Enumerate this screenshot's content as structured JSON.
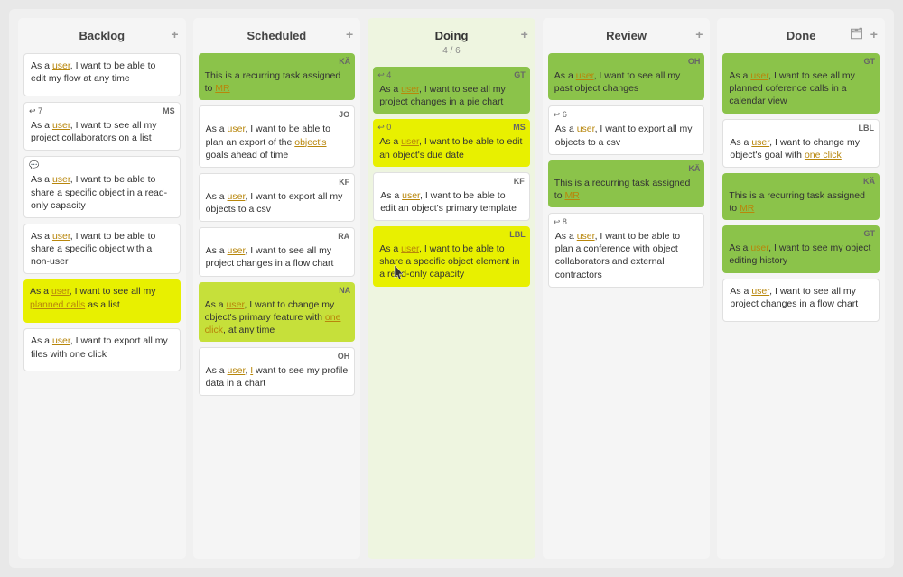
{
  "board": {
    "columns": [
      {
        "id": "backlog",
        "label": "Backlog",
        "sub": "",
        "cards": [
          {
            "id": "b1",
            "bg": "white",
            "text": "As a user, I want to be able to edit my flow at any time",
            "tag": "",
            "num": "",
            "hasIcon": false,
            "links": [
              "user"
            ]
          },
          {
            "id": "b2",
            "bg": "white",
            "tag": "MS",
            "num": "7",
            "text": "As a user, I want to see all my project collaborators on a list",
            "links": [
              "user"
            ],
            "hasIcon": true
          },
          {
            "id": "b3",
            "bg": "white",
            "tag": "",
            "num": "",
            "text": "As a user, I want to be able to share a specific object in a read-only capacity",
            "links": [
              "user"
            ],
            "hasIcon": true,
            "hasBubble": true
          },
          {
            "id": "b4",
            "bg": "white",
            "tag": "",
            "num": "",
            "text": "As a user, I want to be able to share a specific object with a non-user",
            "links": [
              "user"
            ],
            "hasIcon": false
          },
          {
            "id": "b5",
            "bg": "yellow",
            "tag": "",
            "num": "",
            "text": "As a user, I want to see all my planned calls as a list",
            "links": [
              "user",
              "planned calls"
            ],
            "hasIcon": false
          },
          {
            "id": "b6",
            "bg": "white",
            "tag": "",
            "num": "",
            "text": "As a user, I want to export all my files with one click",
            "links": [
              "user"
            ],
            "hasIcon": false
          }
        ]
      },
      {
        "id": "scheduled",
        "label": "Scheduled",
        "sub": "",
        "cards": [
          {
            "id": "s1",
            "bg": "green",
            "tag": "KÄ",
            "num": "",
            "text": "This is a recurring task assigned to MR",
            "links": [
              "MR"
            ]
          },
          {
            "id": "s2",
            "bg": "white",
            "tag": "JO",
            "num": "",
            "text": "As a user, I want to be able to plan an export of the object's goals ahead of time",
            "links": [
              "user",
              "object's"
            ]
          },
          {
            "id": "s3",
            "bg": "white",
            "tag": "KF",
            "num": "",
            "text": "As a user, I want to export all my objects to a csv",
            "links": [
              "user"
            ]
          },
          {
            "id": "s4",
            "bg": "white",
            "tag": "RA",
            "num": "",
            "text": "As a user, I want to see all my project changes in a flow chart",
            "links": [
              "user"
            ]
          },
          {
            "id": "s5",
            "bg": "lime",
            "tag": "NA",
            "num": "",
            "text": "As a user, I want to change my object's primary feature with one click, at any time",
            "links": [
              "user",
              "one click"
            ]
          },
          {
            "id": "s6",
            "bg": "white",
            "tag": "OH",
            "num": "",
            "text": "As a user, I want to see my profile data in a chart",
            "links": [
              "user"
            ],
            "link2": "I"
          }
        ]
      },
      {
        "id": "doing",
        "label": "Doing",
        "sub": "4 / 6",
        "cards": [
          {
            "id": "d1",
            "bg": "green",
            "tag": "GT",
            "num": "4",
            "text": "As a user, I want to see all my project changes in a pie chart",
            "links": [
              "user"
            ]
          },
          {
            "id": "d2",
            "bg": "yellow",
            "tag": "MS",
            "num": "0",
            "text": "As a user, I want to be able to edit an object's due date",
            "links": [
              "user"
            ]
          },
          {
            "id": "d3",
            "bg": "white",
            "tag": "KF",
            "num": "",
            "text": "As a user, I want to be able to edit an object's primary template",
            "links": [
              "user"
            ]
          },
          {
            "id": "d4",
            "bg": "yellow",
            "tag": "LBL",
            "num": "",
            "text": "As a user, I want to be able to share a specific object element in a read-only capacity",
            "links": [
              "user"
            ],
            "hasCursor": true
          }
        ]
      },
      {
        "id": "review",
        "label": "Review",
        "sub": "",
        "cards": [
          {
            "id": "r1",
            "bg": "green",
            "tag": "OH",
            "num": "",
            "text": "As a user, I want to see all my past object changes",
            "links": [
              "user"
            ]
          },
          {
            "id": "r2",
            "bg": "white",
            "tag": "",
            "num": "6",
            "text": "As a user, I want to export all my objects to a csv",
            "links": [
              "user"
            ],
            "hasIcon": true
          },
          {
            "id": "r3",
            "bg": "green",
            "tag": "KÄ",
            "num": "",
            "text": "This is a recurring task assigned to MR",
            "links": [
              "MR"
            ]
          },
          {
            "id": "r4",
            "bg": "white",
            "tag": "",
            "num": "8",
            "text": "As a user, I want to be able to plan a conference with object collaborators and external contractors",
            "links": [
              "user"
            ],
            "hasIcon": true
          }
        ]
      },
      {
        "id": "done",
        "label": "Done",
        "sub": "",
        "cards": [
          {
            "id": "dn1",
            "bg": "green",
            "tag": "GT",
            "num": "",
            "text": "As a user, I want to see all my planned coference calls in a calendar view",
            "links": [
              "user"
            ]
          },
          {
            "id": "dn2",
            "bg": "white",
            "tag": "LBL",
            "num": "",
            "text": "As a user, I want to change my object's goal with one click",
            "links": [
              "user",
              "one click"
            ]
          },
          {
            "id": "dn3",
            "bg": "green",
            "tag": "KÄ",
            "num": "",
            "text": "This is a recurring task assigned to MR",
            "links": [
              "MR"
            ]
          },
          {
            "id": "dn4",
            "bg": "green",
            "tag": "GT",
            "num": "",
            "text": "As a user, I want to see my object editing history",
            "links": [
              "user"
            ]
          },
          {
            "id": "dn5",
            "bg": "white",
            "tag": "",
            "num": "",
            "text": "As a user, I want to see all my project changes in a flow chart",
            "links": [
              "user"
            ]
          }
        ]
      }
    ]
  }
}
